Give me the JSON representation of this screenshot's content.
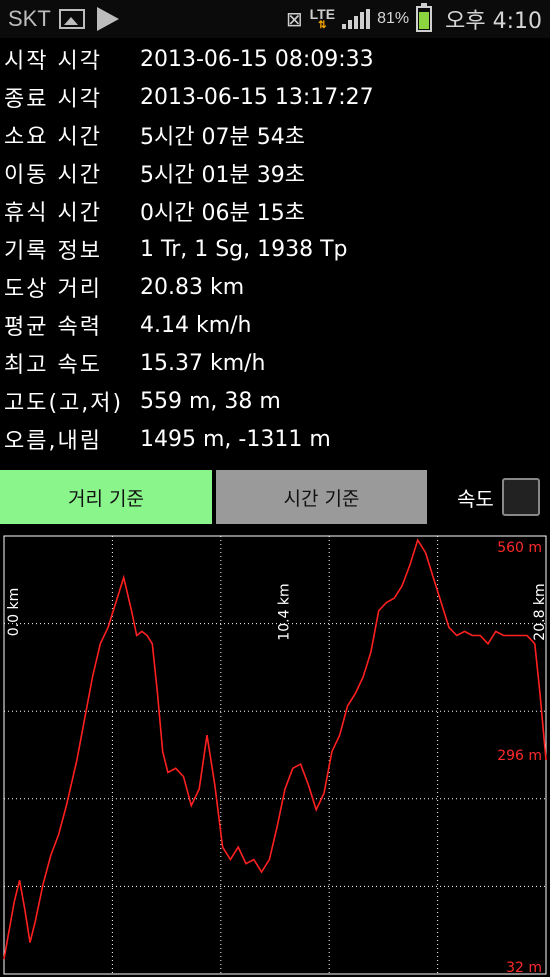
{
  "status_bar": {
    "carrier": "SKT",
    "network": "LTE",
    "battery": "81%",
    "time": "오후 4:10",
    "icons": [
      "gallery-icon",
      "play-icon",
      "vibrate-icon",
      "signal-icon",
      "battery-icon"
    ]
  },
  "stats": [
    {
      "label": "시작 시각",
      "value": "2013-06-15 08:09:33"
    },
    {
      "label": "종료 시각",
      "value": "2013-06-15 13:17:27"
    },
    {
      "label": "소요 시간",
      "value": "5시간 07분 54초"
    },
    {
      "label": "이동 시간",
      "value": "5시간 01분 39초"
    },
    {
      "label": "휴식 시간",
      "value": "0시간 06분 15초"
    },
    {
      "label": "기록 정보",
      "value": "1 Tr, 1 Sg, 1938 Tp"
    },
    {
      "label": "도상 거리",
      "value": "20.83 km"
    },
    {
      "label": "평균 속력",
      "value": "4.14 km/h"
    },
    {
      "label": "최고 속도",
      "value": "15.37 km/h"
    },
    {
      "label": "고도(고,저)",
      "value": "559 m, 38 m"
    },
    {
      "label": "오름,내림",
      "value": "1495 m, -1311 m"
    }
  ],
  "controls": {
    "distance_button": "거리 기준",
    "time_button": "시간 기준",
    "speed_label": "속도",
    "speed_checked": false
  },
  "colors": {
    "background": "#000000",
    "active_button": "#89f58a",
    "inactive_button": "#9a9a9a",
    "line": "#ff2020",
    "grid": "#ffffff"
  },
  "chart_data": {
    "type": "line",
    "x_tick_labels": [
      "0.0 km",
      "10.4 km",
      "20.8 km"
    ],
    "x_ticks": [
      0,
      10.4,
      20.8
    ],
    "y_tick_labels": [
      "560 m",
      "296 m",
      "32 m"
    ],
    "y_ticks": [
      560,
      296,
      32
    ],
    "xlim": [
      0,
      20.83
    ],
    "ylim": [
      32,
      560
    ],
    "grid": true,
    "series": [
      {
        "x": [
          0.0,
          0.2,
          0.4,
          0.6,
          0.8,
          1.0,
          1.2,
          1.5,
          1.8,
          2.1,
          2.4,
          2.8,
          3.1,
          3.4,
          3.7,
          4.0,
          4.3,
          4.6,
          4.9,
          5.1,
          5.3,
          5.5,
          5.7,
          5.9,
          6.1,
          6.3,
          6.6,
          6.9,
          7.2,
          7.5,
          7.8,
          8.1,
          8.4,
          8.7,
          9.0,
          9.3,
          9.6,
          9.9,
          10.2,
          10.5,
          10.8,
          11.1,
          11.4,
          11.7,
          12.0,
          12.3,
          12.6,
          12.9,
          13.2,
          13.5,
          13.8,
          14.1,
          14.4,
          14.7,
          15.0,
          15.3,
          15.6,
          15.9,
          16.2,
          16.5,
          16.8,
          17.1,
          17.4,
          17.7,
          18.0,
          18.3,
          18.6,
          18.9,
          19.2,
          19.5,
          19.8,
          20.1,
          20.4,
          20.6,
          20.83
        ],
        "y": [
          50,
          85,
          120,
          145,
          110,
          70,
          95,
          140,
          175,
          200,
          235,
          290,
          340,
          390,
          430,
          450,
          480,
          510,
          470,
          440,
          445,
          440,
          430,
          370,
          300,
          275,
          280,
          270,
          235,
          255,
          320,
          260,
          185,
          170,
          185,
          165,
          170,
          155,
          170,
          210,
          255,
          280,
          285,
          260,
          230,
          250,
          300,
          320,
          355,
          370,
          390,
          420,
          470,
          480,
          485,
          500,
          525,
          555,
          540,
          510,
          480,
          450,
          440,
          445,
          440,
          440,
          430,
          445,
          440,
          440,
          440,
          440,
          430,
          370,
          290
        ]
      }
    ]
  }
}
